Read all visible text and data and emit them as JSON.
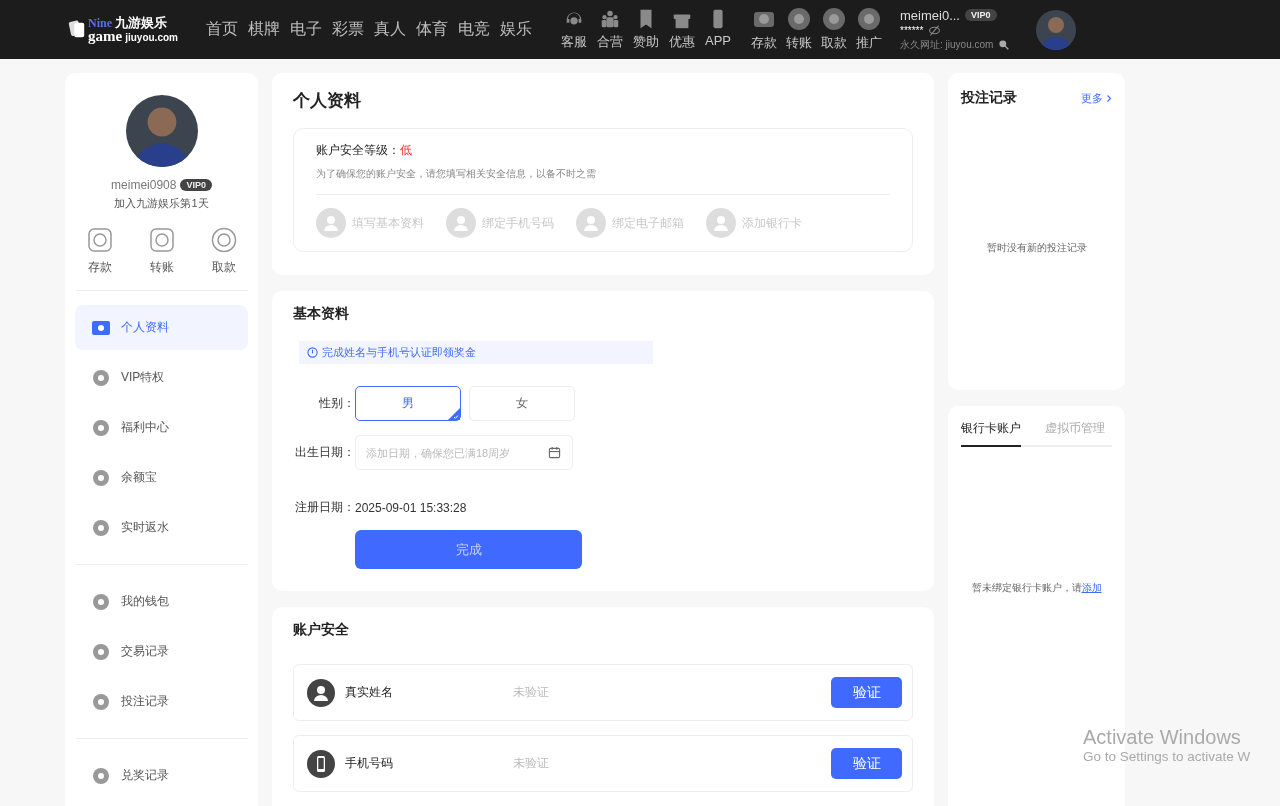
{
  "header": {
    "logo": {
      "brand_top": "Nine",
      "brand_word": "game",
      "brand_cn": "九游娱乐",
      "domain": "jiuyou.com"
    },
    "nav": [
      "首页",
      "棋牌",
      "电子",
      "彩票",
      "真人",
      "体育",
      "电竞",
      "娱乐"
    ],
    "service_links": [
      "客服",
      "合营",
      "赞助",
      "优惠",
      "APP"
    ],
    "wallet_links": [
      "存款",
      "转账",
      "取款",
      "推广"
    ],
    "user": {
      "name": "meimei0...",
      "vip": "VIP0",
      "balance": "******",
      "site": "永久网址: jiuyou.com"
    }
  },
  "sidebar": {
    "username": "meimei0908",
    "vip": "VIP0",
    "joined": "加入九游娱乐第1天",
    "quick_actions": [
      "存款",
      "转账",
      "取款"
    ],
    "menu_groups": [
      [
        {
          "label": "个人资料",
          "selected": true
        },
        {
          "label": "VIP特权",
          "selected": false
        },
        {
          "label": "福利中心",
          "selected": false
        },
        {
          "label": "余额宝",
          "selected": false
        },
        {
          "label": "实时返水",
          "selected": false
        }
      ],
      [
        {
          "label": "我的钱包",
          "selected": false
        },
        {
          "label": "交易记录",
          "selected": false
        },
        {
          "label": "投注记录",
          "selected": false
        }
      ],
      [
        {
          "label": "兑奖记录",
          "selected": false
        }
      ]
    ]
  },
  "profile": {
    "title": "个人资料",
    "security_label": "账户安全等级：",
    "security_level": "低",
    "description": "为了确保您的账户安全，请您填写相关安全信息，以备不时之需",
    "steps": [
      {
        "label": "填写基本资料",
        "done": false
      },
      {
        "label": "绑定手机号码",
        "done": false
      },
      {
        "label": "绑定电子邮箱",
        "done": false
      },
      {
        "label": "添加银行卡",
        "done": false
      }
    ]
  },
  "basic_info": {
    "title": "基本资料",
    "notice": "完成姓名与手机号认证即领奖金",
    "gender": {
      "label": "性别：",
      "options": [
        {
          "label": "男",
          "selected": true
        },
        {
          "label": "女",
          "selected": false
        }
      ]
    },
    "birthday": {
      "label": "出生日期：",
      "placeholder": "添加日期，确保您已满18周岁"
    },
    "registered": {
      "label": "注册日期：",
      "value": "2025-09-01 15:33:28"
    },
    "submit": "完成"
  },
  "account_security": {
    "title": "账户安全",
    "rows": [
      {
        "name": "真实姓名",
        "status": "未验证",
        "action": "验证"
      },
      {
        "name": "手机号码",
        "status": "未验证",
        "action": "验证"
      }
    ]
  },
  "bet_records": {
    "title": "投注记录",
    "more": "更多",
    "empty": "暂时没有新的投注记录"
  },
  "accounts": {
    "tabs": [
      {
        "label": "银行卡账户",
        "selected": true
      },
      {
        "label": "虚拟币管理",
        "selected": false
      }
    ],
    "empty": "暂未绑定银行卡账户，请",
    "add_link": "添加"
  },
  "os_notice": {
    "title": "Activate Windows",
    "subtitle": "Go to Settings to activate W"
  }
}
